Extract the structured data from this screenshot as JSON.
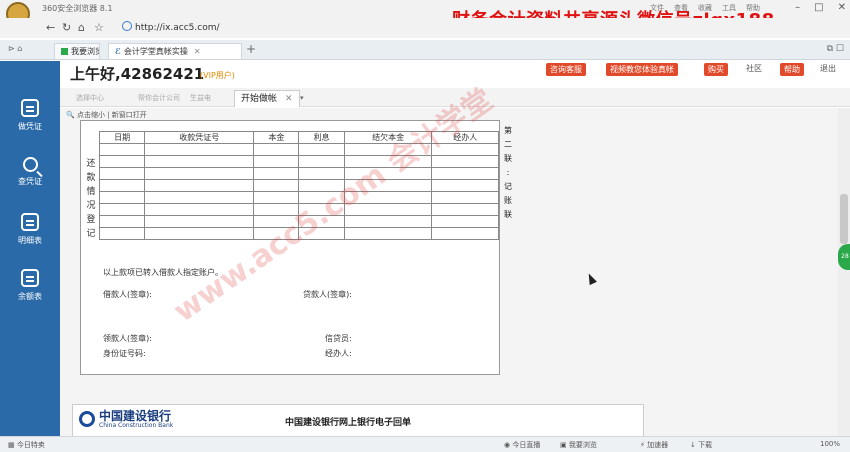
{
  "browser": {
    "title": "360安全浏览器 8.1",
    "menu": [
      "文件",
      "查看",
      "收藏",
      "工具",
      "帮助"
    ],
    "url": "http://ix.acc5.com/",
    "tabs": [
      {
        "label": "我要浏览"
      },
      {
        "label": "会计学堂真帐实操"
      }
    ],
    "watermark_text": "财务会计资料共享源头微信号zlgx188"
  },
  "app": {
    "greeting": "上午好,42862421",
    "vip": "(VIP用户)",
    "header_buttons": [
      "咨询客服",
      "视频教您体验真帐",
      "购买",
      "帮助"
    ],
    "header_links": [
      "社区",
      "退出"
    ],
    "sidebar": [
      {
        "label": "做凭证",
        "icon": "voucher-icon"
      },
      {
        "label": "查凭证",
        "icon": "search-icon"
      },
      {
        "label": "明细表",
        "icon": "ledger-icon"
      },
      {
        "label": "余额表",
        "icon": "balance-icon"
      }
    ],
    "subtabs": [
      {
        "label": "选择中心"
      },
      {
        "label": "帮你会计公司"
      },
      {
        "label": "生益电"
      },
      {
        "label": "开始做帐"
      }
    ],
    "toolstrip": "点击缩小  |  新窗口打开"
  },
  "document": {
    "side_label": "还款情况登记",
    "copy_label": "第二联:记账联",
    "table_headers": [
      "日期",
      "收款凭证号",
      "本金",
      "利息",
      "结欠本金",
      "经办人"
    ],
    "row_count": 8,
    "note": "以上款项已转入借款人指定账户。",
    "borrower_sign": "借款人(签章):",
    "lender_sign": "贷款人(签章):",
    "receiver_sign": "领款人(签章):",
    "credit_officer": "信贷员:",
    "id_number": "身份证号码:",
    "handler": "经办人:",
    "watermark": "www.acc5.com 会计学堂"
  },
  "bank_receipt": {
    "bank_name": "中国建设银行",
    "bank_name_en": "China Construction Bank",
    "title": "中国建设银行网上银行电子回单"
  },
  "status": {
    "left": "今日特卖",
    "items": [
      "今日直播",
      "我要浏览",
      "加速器",
      "下载"
    ],
    "zoom": "100%"
  }
}
